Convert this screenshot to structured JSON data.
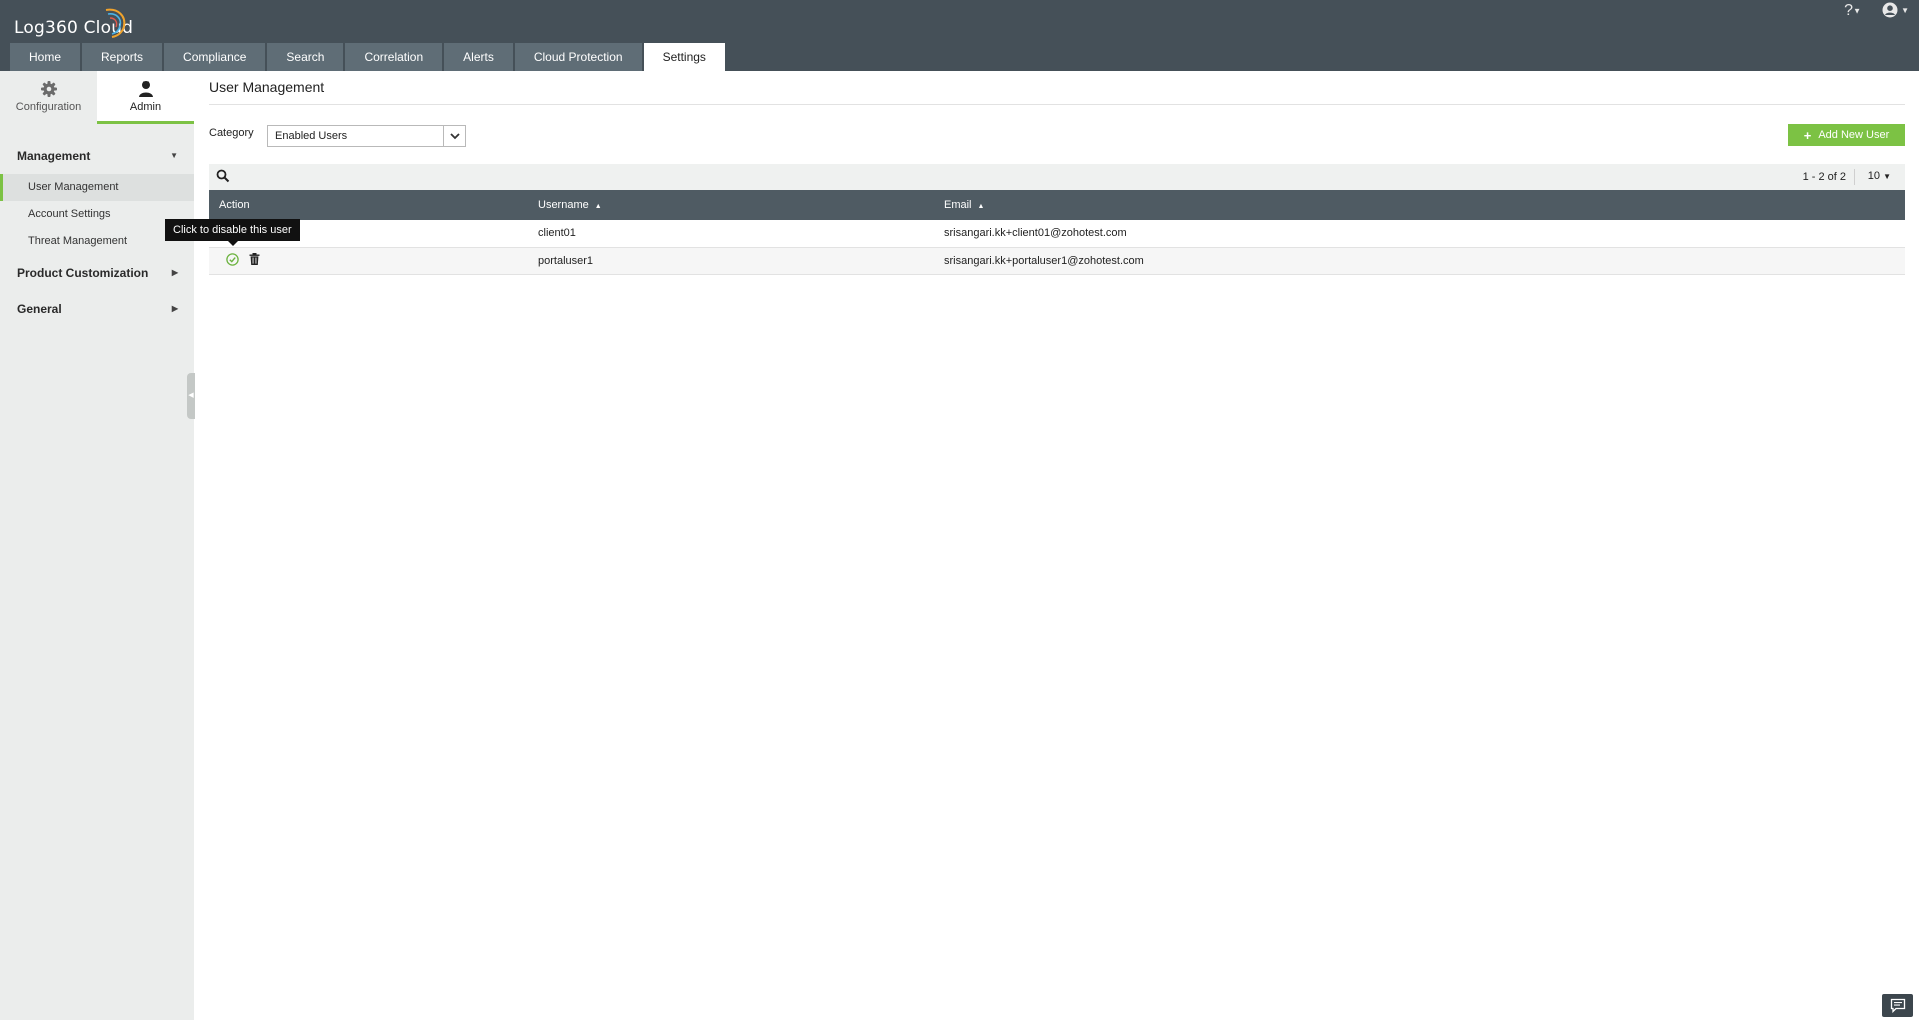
{
  "app": {
    "logo_text": "Log360  Cloud",
    "help_label": "?"
  },
  "tabs": [
    {
      "label": "Home"
    },
    {
      "label": "Reports"
    },
    {
      "label": "Compliance"
    },
    {
      "label": "Search"
    },
    {
      "label": "Correlation"
    },
    {
      "label": "Alerts"
    },
    {
      "label": "Cloud Protection"
    },
    {
      "label": "Settings",
      "active": true
    }
  ],
  "sidebar": {
    "subtabs": [
      {
        "label": "Configuration",
        "icon": "gear-icon"
      },
      {
        "label": "Admin",
        "icon": "admin-user-icon",
        "active": true
      }
    ],
    "sections": [
      {
        "label": "Management",
        "expanded": true,
        "items": [
          {
            "label": "User Management",
            "active": true
          },
          {
            "label": "Account Settings"
          },
          {
            "label": "Threat Management"
          }
        ]
      },
      {
        "label": "Product Customization",
        "expanded": false
      },
      {
        "label": "General",
        "expanded": false
      }
    ]
  },
  "main": {
    "title": "User Management",
    "category": {
      "label": "Category",
      "selected": "Enabled Users"
    },
    "add_button_label": "Add New User",
    "pagination": {
      "range": "1 - 2 of 2",
      "per_page": "10"
    },
    "table": {
      "columns": [
        "Action",
        "Username",
        "Email"
      ],
      "rows": [
        {
          "username": "client01",
          "email": "srisangari.kk+client01@zohotest.com"
        },
        {
          "username": "portaluser1",
          "email": "srisangari.kk+portaluser1@zohotest.com"
        }
      ]
    },
    "tooltip": "Click to disable this user"
  },
  "colors": {
    "topbar": "#455058",
    "tab_inactive": "#5f6d76",
    "accent_green": "#7cc244",
    "table_header": "#4f5b63",
    "sidebar_bg": "#ebedec"
  }
}
